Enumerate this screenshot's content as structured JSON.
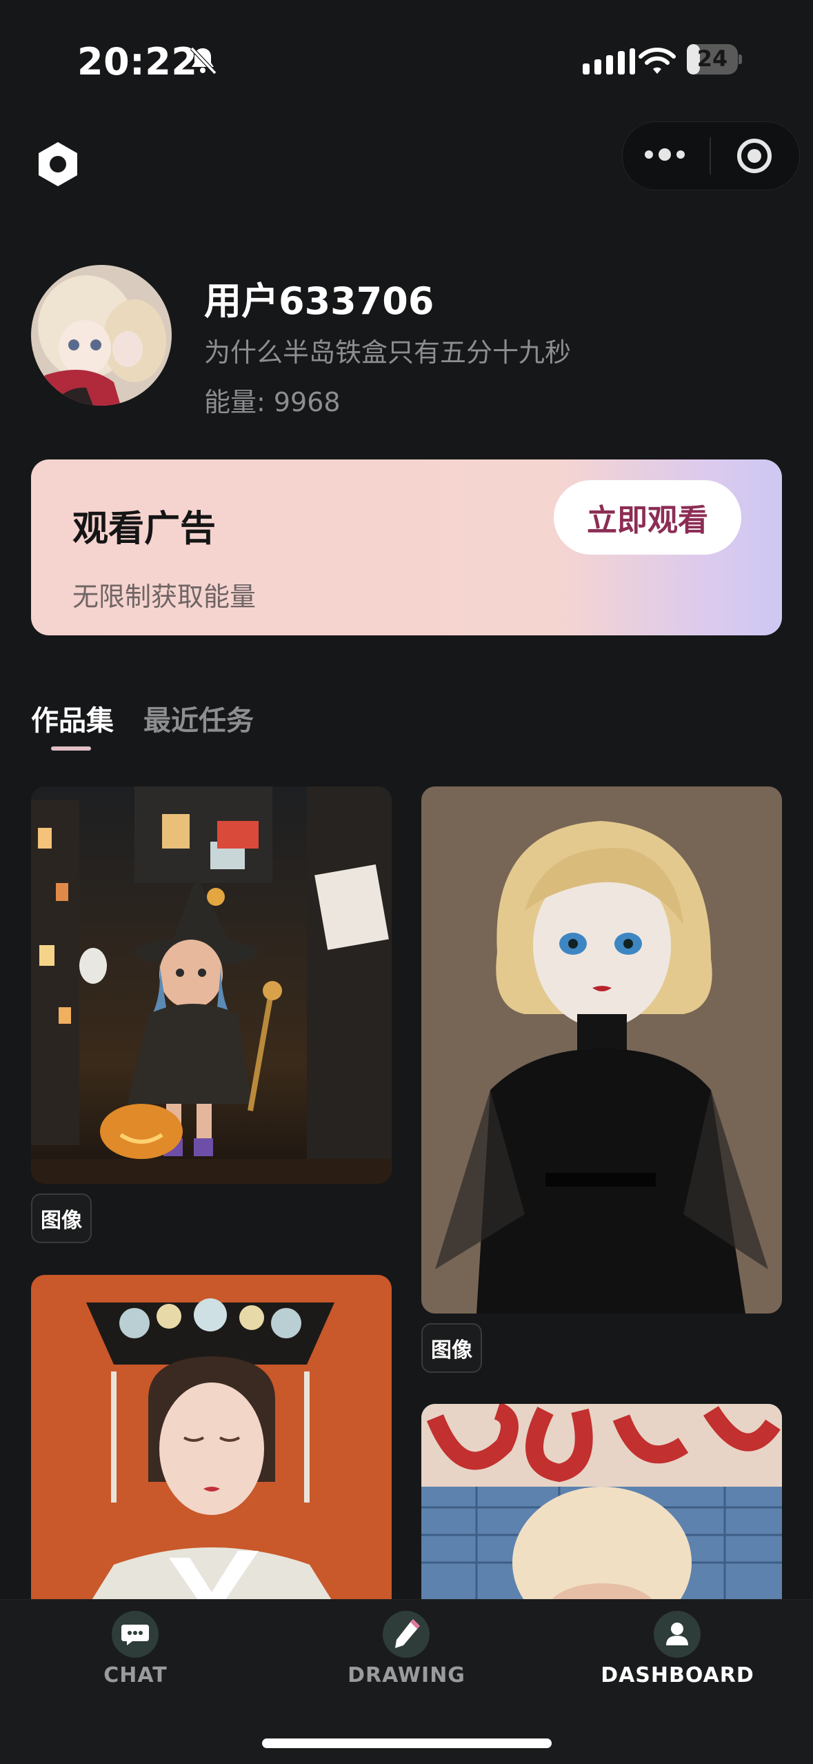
{
  "status_bar": {
    "time": "20:22",
    "battery_level": "24",
    "icons": [
      "bell-slash-icon",
      "cellular-signal-icon",
      "wifi-icon",
      "battery-icon"
    ]
  },
  "top_bar": {
    "left_icon": "hexagon-settings-icon",
    "capsule_icons": [
      "more-dots-icon",
      "target-circle-icon"
    ]
  },
  "profile": {
    "username": "用户633706",
    "bio": "为什么半岛铁盒只有五分十九秒",
    "energy": "能量: 9968"
  },
  "ad_card": {
    "title": "观看广告",
    "subtitle": "无限制获取能量",
    "button_label": "立即观看"
  },
  "tabs": [
    {
      "label": "作品集",
      "active": true
    },
    {
      "label": "最近任务",
      "active": false
    }
  ],
  "gallery": {
    "items": [
      {
        "tag": "图像",
        "subject": "witch-doll-city-night"
      },
      {
        "tag": "图像",
        "subject": "blonde-doll-black-dress"
      },
      {
        "subject": "qing-dynasty-headdress-portrait"
      },
      {
        "subject": "fluffy-hat-sign-background"
      }
    ]
  },
  "bottom_nav": {
    "items": [
      {
        "label": "CHAT",
        "icon": "chat-bubble-icon",
        "active": false
      },
      {
        "label": "DRAWING",
        "icon": "pencil-icon",
        "active": false
      },
      {
        "label": "DASHBOARD",
        "icon": "user-icon",
        "active": true
      }
    ]
  },
  "colors": {
    "background": "#161718",
    "accent_button_text": "#8c2d54",
    "inactive_text": "#8d8e90",
    "active_nav": "#ffffff",
    "inactive_nav": "#9a9b9d"
  }
}
